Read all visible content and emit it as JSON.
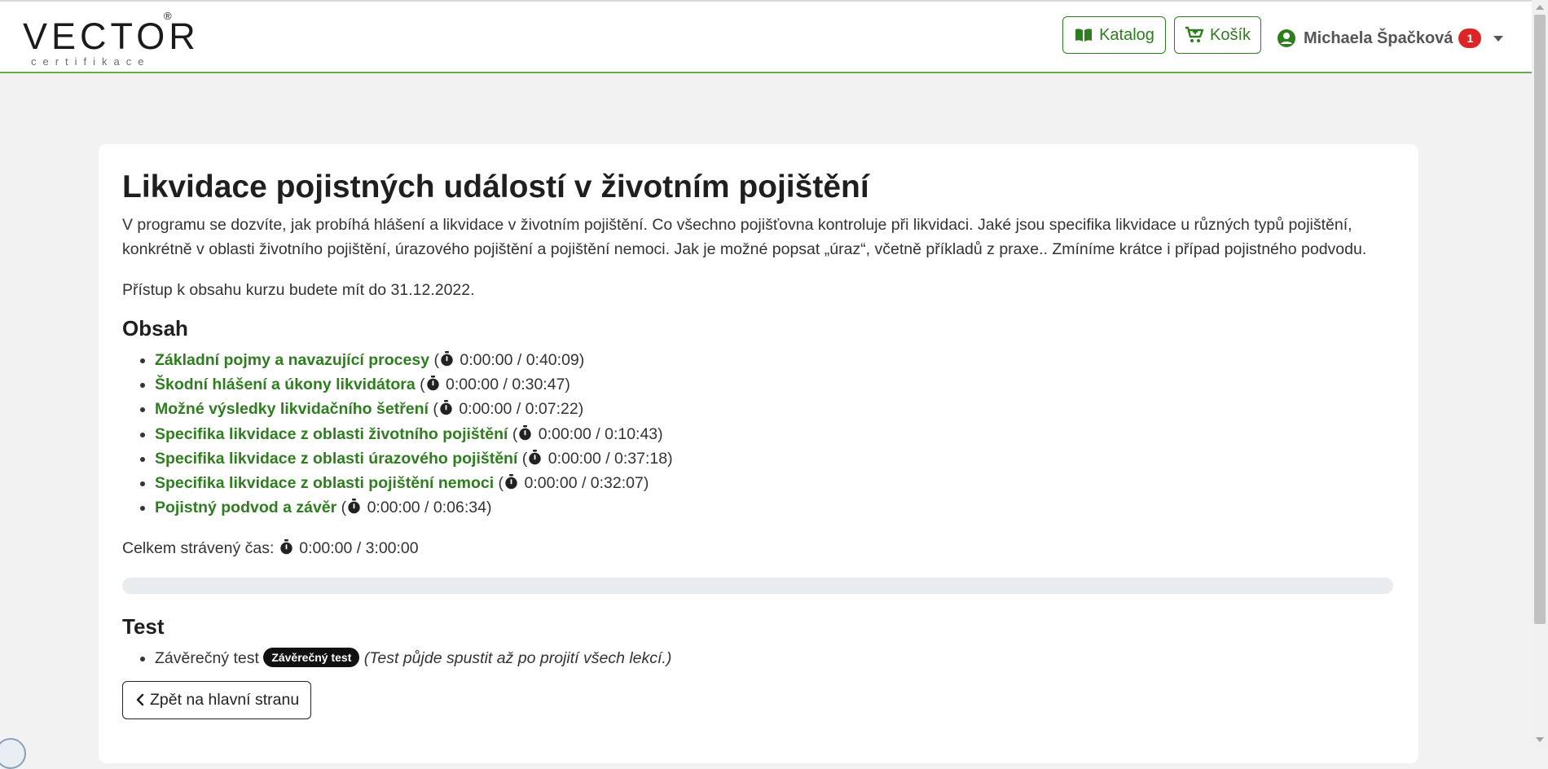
{
  "header": {
    "logo_text": "VECTOR",
    "logo_reg": "®",
    "logo_sub": "certifikace",
    "catalog_label": "Katalog",
    "cart_label": "Košík",
    "user_name": "Michaela Špačková",
    "notification_count": "1"
  },
  "course": {
    "title": "Likvidace pojistných událostí v životním pojištění",
    "description": "V programu se dozvíte, jak probíhá hlášení a likvidace v životním pojištění. Co všechno pojišťovna kontroluje při likvidaci. Jaké jsou specifika likvidace u různých typů pojištění, konkrétně v oblasti životního pojištění, úrazového pojištění a pojištění nemoci. Jak je možné popsat „úraz“, včetně příkladů z praxe.. Zmíníme krátce i případ pojistného podvodu.",
    "access_text": "Přístup k obsahu kurzu budete mít do 31.12.2022."
  },
  "contents": {
    "heading": "Obsah",
    "lessons": [
      {
        "title": "Základní pojmy a navazující procesy",
        "time": "0:00:00 / 0:40:09"
      },
      {
        "title": "Škodní hlášení a úkony likvidátora",
        "time": "0:00:00 / 0:30:47"
      },
      {
        "title": "Možné výsledky likvidačního šetření",
        "time": "0:00:00 / 0:07:22"
      },
      {
        "title": "Specifika likvidace z oblasti životního pojištění",
        "time": "0:00:00 / 0:10:43"
      },
      {
        "title": "Specifika likvidace z oblasti úrazového pojištění",
        "time": "0:00:00 / 0:37:18"
      },
      {
        "title": "Specifika likvidace z oblasti pojištění nemoci",
        "time": "0:00:00 / 0:32:07"
      },
      {
        "title": "Pojistný podvod a závěr",
        "time": "0:00:00 / 0:06:34"
      }
    ],
    "total_label": "Celkem strávený čas:",
    "total_time": "0:00:00 / 3:00:00",
    "progress_fraction": 0
  },
  "test": {
    "heading": "Test",
    "item_label": "Závěrečný test",
    "badge": "Závěrečný test",
    "note": "(Test půjde spustit až po projití všech lekcí.)"
  },
  "back_button_label": "Zpět na hlavní stranu",
  "colors": {
    "accent": "#2e7d1f",
    "navbar_border": "#6aa84f",
    "badge_red": "#dc2626",
    "background": "#f2f2f2"
  },
  "icons": [
    "book-open-icon",
    "cart-plus-icon",
    "user-circle-icon",
    "caret-down-icon",
    "stopwatch-icon",
    "chevron-left-icon"
  ]
}
